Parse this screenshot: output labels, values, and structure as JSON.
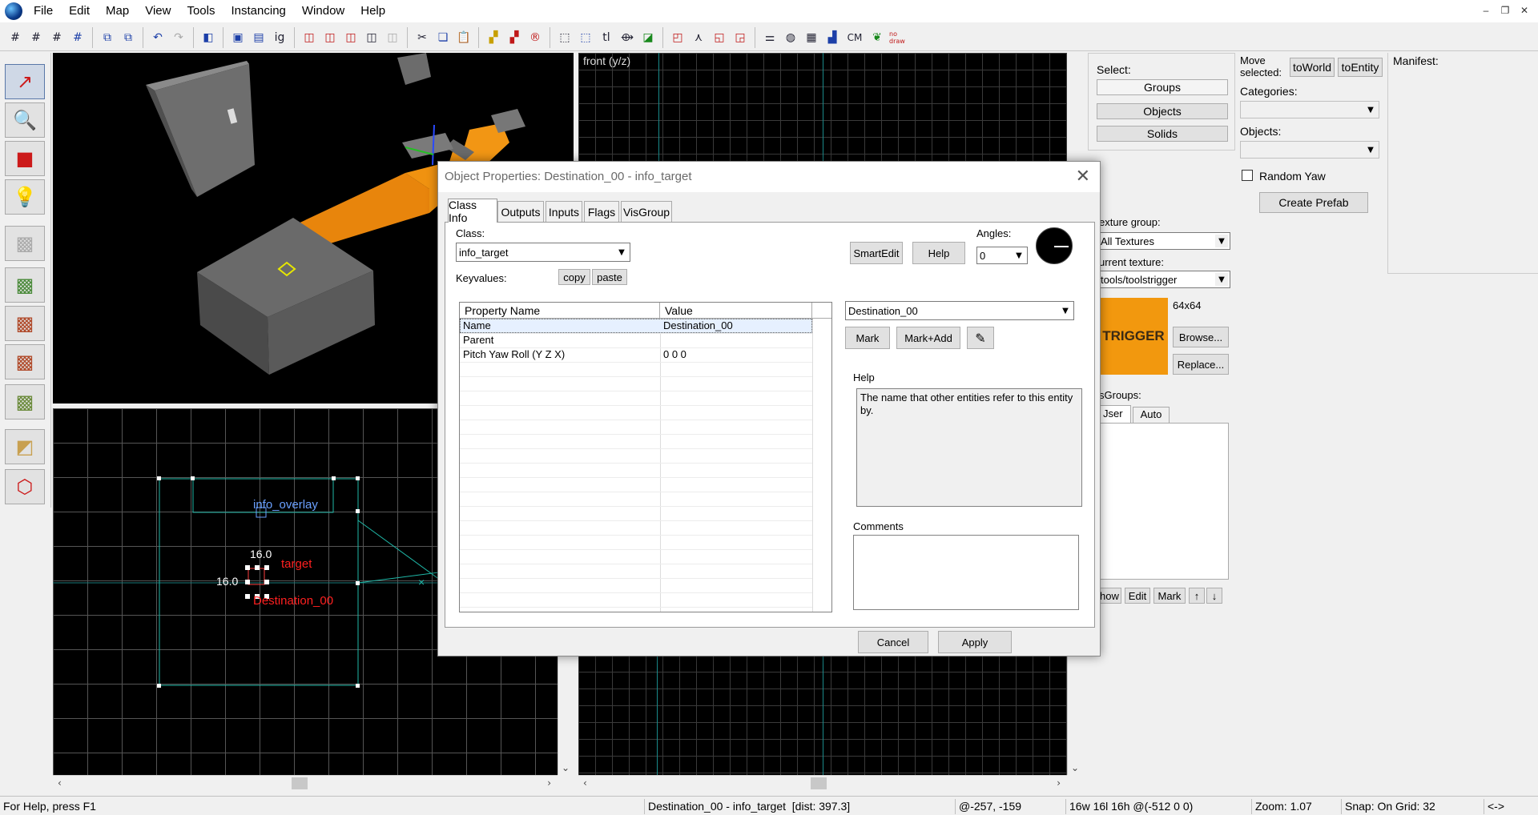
{
  "menubar": {
    "items": [
      "File",
      "Edit",
      "Map",
      "View",
      "Tools",
      "Instancing",
      "Window",
      "Help"
    ]
  },
  "toolbar": {
    "text_buttons": [
      "ig",
      "tl",
      "CM"
    ]
  },
  "viewports": {
    "front_label": "front (y/z)",
    "top_left_labels": {
      "overlay": "info_overlay",
      "entity_partial": "target",
      "entity_name": "Destination_00",
      "dim_top": "16.0",
      "dim_left": "16.0"
    }
  },
  "right_panel": {
    "select_label": "Select:",
    "groups": "Groups",
    "objects": "Objects",
    "solids": "Solids",
    "move_selected": "Move selected:",
    "to_world": "toWorld",
    "to_entity": "toEntity",
    "categories_label": "Categories:",
    "objects_label": "Objects:",
    "random_yaw": "Random Yaw",
    "create_prefab": "Create Prefab",
    "manifest": "Manifest:",
    "texture_group_label": "exture group:",
    "texture_group_value": "All Textures",
    "current_texture_label": "urrent texture:",
    "current_texture_value": "tools/toolstrigger",
    "texture_swatch_text": "TRIGGER",
    "texture_size": "64x64",
    "browse": "Browse...",
    "replace": "Replace...",
    "visgroups_label": "sGroups:",
    "tab_user": "Jser",
    "tab_auto": "Auto",
    "show": "how",
    "edit": "Edit",
    "mark": "Mark",
    "up": "↑",
    "down": "↓"
  },
  "dialog": {
    "title": "Object Properties: Destination_00 - info_target",
    "tabs": [
      "Class Info",
      "Outputs",
      "Inputs",
      "Flags",
      "VisGroup"
    ],
    "class_label": "Class:",
    "class_value": "info_target",
    "keyvalues_label": "Keyvalues:",
    "copy": "copy",
    "paste": "paste",
    "smartedit": "SmartEdit",
    "help_button": "Help",
    "angles_label": "Angles:",
    "angles_value": "0",
    "columns": [
      "Property Name",
      "Value"
    ],
    "rows": [
      {
        "name": "Name",
        "value": "Destination_00"
      },
      {
        "name": "Parent",
        "value": ""
      },
      {
        "name": "Pitch Yaw Roll (Y Z X)",
        "value": "0 0 0"
      }
    ],
    "value_editor": "Destination_00",
    "mark": "Mark",
    "mark_add": "Mark+Add",
    "help_label": "Help",
    "help_text": "The name that other entities refer to this entity by.",
    "comments_label": "Comments",
    "cancel": "Cancel",
    "apply": "Apply"
  },
  "statusbar": {
    "help": "For Help, press F1",
    "selection": "Destination_00 - info_target  [dist: 397.3]",
    "coords": "@-257, -159",
    "size": "16w 16l 16h @(-512 0 0)",
    "zoom": "Zoom: 1.07",
    "snap": "Snap: On Grid: 32",
    "arrows": "<->"
  },
  "colors": {
    "accent_orange": "#f0900a",
    "entity_red": "#ff2020",
    "overlay_blue": "#6aa0ff",
    "select_cyan": "#1fb8a8"
  }
}
